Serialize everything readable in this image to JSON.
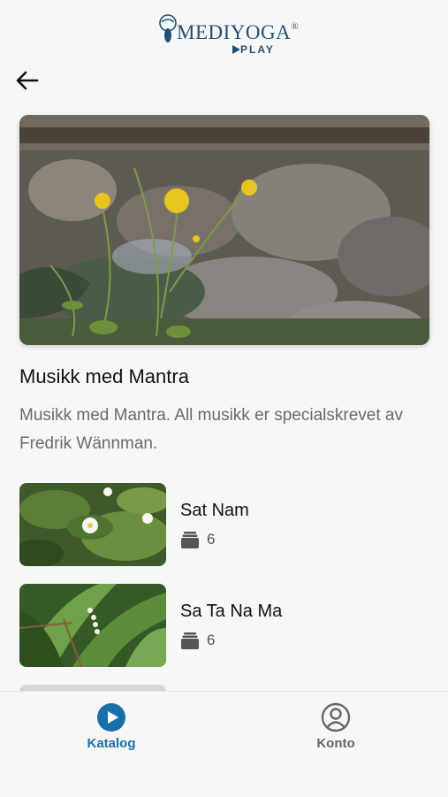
{
  "header": {
    "logo_text": "MEDIYOGA",
    "logo_reg": "®",
    "logo_sub": "PLAY"
  },
  "collection": {
    "title": "Musikk med Mantra",
    "description": "Musikk med Mantra. All musikk er specialskrevet av Fredrik Wännman."
  },
  "items": [
    {
      "title": "Sat Nam",
      "count": "6"
    },
    {
      "title": "Sa Ta Na Ma",
      "count": "6"
    }
  ],
  "tabbar": {
    "tabs": [
      {
        "label": "Katalog",
        "active": true
      },
      {
        "label": "Konto",
        "active": false
      }
    ]
  },
  "colors": {
    "accent": "#1a6fa8",
    "inactive": "#666666",
    "logo": "#1f4f78"
  }
}
